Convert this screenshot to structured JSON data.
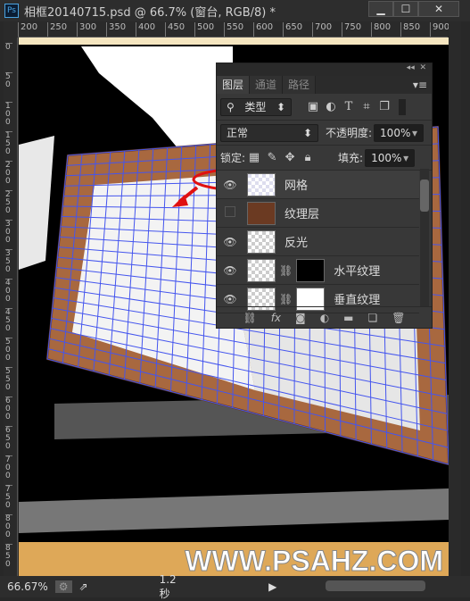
{
  "window": {
    "title": "相框20140715.psd @ 66.7% (窗台, RGB/8) *",
    "app_icon": "Ps",
    "minimize": "▁",
    "maximize": "☐",
    "close": "✕"
  },
  "ruler_top": [
    "200",
    "250",
    "300",
    "350",
    "400",
    "450",
    "500",
    "550",
    "600",
    "650",
    "700",
    "750",
    "800",
    "850",
    "900"
  ],
  "ruler_left": [
    "0",
    "50",
    "100",
    "150",
    "200",
    "250",
    "300",
    "350",
    "400",
    "450",
    "500",
    "550",
    "600",
    "650",
    "700",
    "750",
    "800",
    "850"
  ],
  "layers_panel": {
    "collapse": "◂◂",
    "close": "✕",
    "menu": "▾≡",
    "tabs": [
      {
        "label": "图层",
        "active": true
      },
      {
        "label": "通道"
      },
      {
        "label": "路径"
      }
    ],
    "filter": {
      "value": "类型",
      "icons": [
        "image-filter-icon",
        "adjustment-filter-icon",
        "type-filter-icon",
        "shape-filter-icon",
        "smart-object-filter-icon"
      ]
    },
    "blend_mode": "正常",
    "opacity_label": "不透明度:",
    "opacity": "100%",
    "lock_label": "锁定:",
    "fill_label": "填充:",
    "fill": "100%",
    "layers": [
      {
        "name": "网格",
        "visible": true,
        "selected": true
      },
      {
        "name": "纹理层",
        "visible": false
      },
      {
        "name": "反光",
        "visible": true
      },
      {
        "name": "水平纹理",
        "visible": true,
        "mask": true
      },
      {
        "name": "垂直纹理",
        "visible": true,
        "mask": true
      }
    ],
    "bottom": [
      "link-icon",
      "fx",
      "mask-icon",
      "adjustment-icon",
      "group-icon",
      "new-layer-icon",
      "trash-icon"
    ],
    "fx_label": "fx"
  },
  "canvas": {
    "watermark": "WWW.PSAHZ.COM",
    "banner_color": "#dea858",
    "grid_color": "#4455ee",
    "annotation_color": "#e01010"
  },
  "status": {
    "zoom": "66.67%",
    "timing": "1.2 秒"
  }
}
